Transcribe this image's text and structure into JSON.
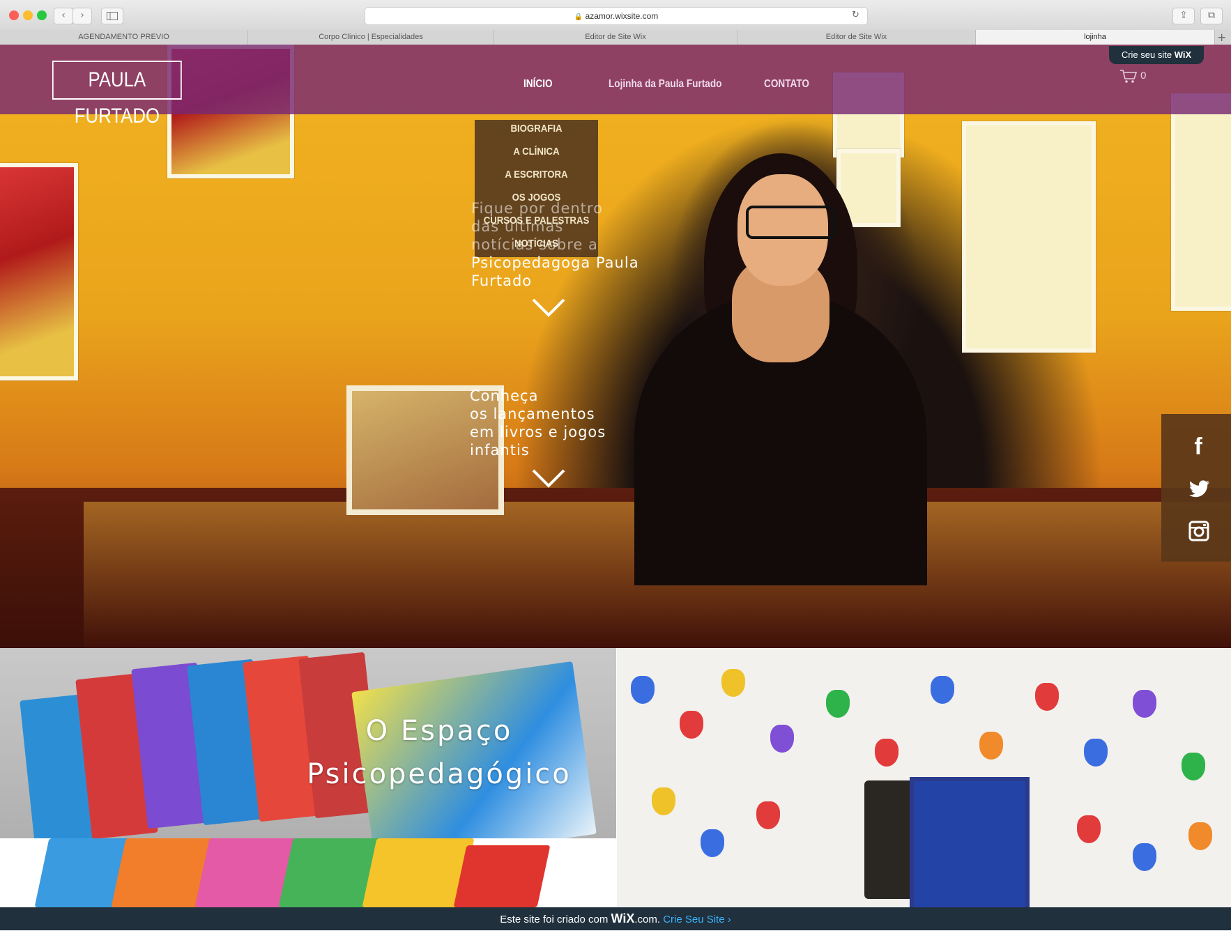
{
  "browser": {
    "url": "azamor.wixsite.com",
    "tabs": [
      {
        "label": "AGENDAMENTO PREVIO"
      },
      {
        "label": "Corpo Clínico | Especialidades"
      },
      {
        "label": "Editor de Site Wix"
      },
      {
        "label": "Editor de Site Wix"
      },
      {
        "label": "lojinha"
      }
    ],
    "new_tab": "+"
  },
  "header": {
    "logo": "PAULA FURTADO",
    "nav": [
      {
        "label": "INÍCIO"
      },
      {
        "label": "Lojinha da Paula Furtado"
      },
      {
        "label": "CONTATO"
      }
    ],
    "cart_count": "0",
    "wix_badge_text": "Crie seu site",
    "wix_badge_brand": "WiX"
  },
  "submenu": [
    {
      "label": "BIOGRAFIA"
    },
    {
      "label": "A CLÍNICA"
    },
    {
      "label": "A ESCRITORA"
    },
    {
      "label": "OS JOGOS"
    },
    {
      "label": "CURSOS E PALESTRAS"
    },
    {
      "label": "NOTÍCIAS"
    }
  ],
  "hero": {
    "text1_lines": [
      "Fique por dentro",
      "das últimas",
      "notícias sobre a",
      "Psicopedagoga Paula",
      "Furtado"
    ],
    "text2_lines": [
      "Conheça",
      "os lançamentos",
      "em livros e jogos",
      "infantis"
    ]
  },
  "section": {
    "title_line1": "O Espaço",
    "title_line2": "Psicopedagógico"
  },
  "footer": {
    "prefix": "Este site foi criado com",
    "brand": "WiX",
    "suffix": ".com.",
    "link": "Crie Seu Site ›"
  },
  "colors": {
    "navbar": "#782873",
    "footer": "#20303c",
    "link": "#3bb3ff"
  }
}
